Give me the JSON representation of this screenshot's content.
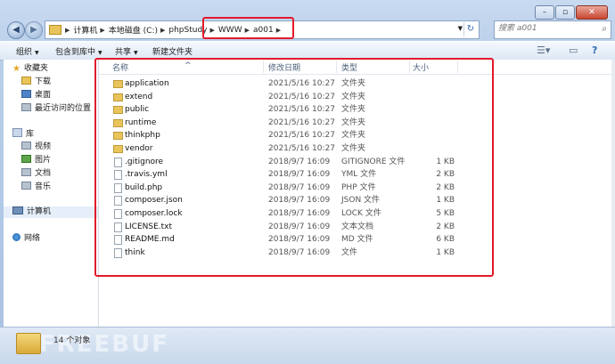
{
  "window": {
    "caption_buttons": [
      "minimize",
      "maximize",
      "close"
    ]
  },
  "address": {
    "crumbs": [
      "计算机",
      "本地磁盘 (C:)",
      "phpStudy",
      "WWW",
      "a001"
    ]
  },
  "search": {
    "placeholder": "搜索 a001"
  },
  "toolbar": {
    "organize": "组织",
    "include_library": "包含到库中",
    "share": "共享",
    "new_folder": "新建文件夹"
  },
  "sidebar": {
    "favorites": "收藏夹",
    "downloads": "下载",
    "desktop": "桌面",
    "recent": "最近访问的位置",
    "libraries": "库",
    "videos": "视频",
    "pictures": "图片",
    "documents": "文档",
    "music": "音乐",
    "computer": "计算机",
    "network": "网络"
  },
  "columns": {
    "name": "名称",
    "date": "修改日期",
    "type": "类型",
    "size": "大小"
  },
  "files": [
    {
      "name": "application",
      "date": "2021/5/16 10:27",
      "type": "文件夹",
      "size": "",
      "kind": "folder"
    },
    {
      "name": "extend",
      "date": "2021/5/16 10:27",
      "type": "文件夹",
      "size": "",
      "kind": "folder"
    },
    {
      "name": "public",
      "date": "2021/5/16 10:27",
      "type": "文件夹",
      "size": "",
      "kind": "folder"
    },
    {
      "name": "runtime",
      "date": "2021/5/16 10:27",
      "type": "文件夹",
      "size": "",
      "kind": "folder"
    },
    {
      "name": "thinkphp",
      "date": "2021/5/16 10:27",
      "type": "文件夹",
      "size": "",
      "kind": "folder"
    },
    {
      "name": "vendor",
      "date": "2021/5/16 10:27",
      "type": "文件夹",
      "size": "",
      "kind": "folder"
    },
    {
      "name": ".gitignore",
      "date": "2018/9/7 16:09",
      "type": "GITIGNORE 文件",
      "size": "1 KB",
      "kind": "file"
    },
    {
      "name": ".travis.yml",
      "date": "2018/9/7 16:09",
      "type": "YML 文件",
      "size": "2 KB",
      "kind": "file"
    },
    {
      "name": "build.php",
      "date": "2018/9/7 16:09",
      "type": "PHP 文件",
      "size": "2 KB",
      "kind": "file"
    },
    {
      "name": "composer.json",
      "date": "2018/9/7 16:09",
      "type": "JSON 文件",
      "size": "1 KB",
      "kind": "file"
    },
    {
      "name": "composer.lock",
      "date": "2018/9/7 16:09",
      "type": "LOCK 文件",
      "size": "5 KB",
      "kind": "file"
    },
    {
      "name": "LICENSE.txt",
      "date": "2018/9/7 16:09",
      "type": "文本文档",
      "size": "2 KB",
      "kind": "file"
    },
    {
      "name": "README.md",
      "date": "2018/9/7 16:09",
      "type": "MD 文件",
      "size": "6 KB",
      "kind": "file"
    },
    {
      "name": "think",
      "date": "2018/9/7 16:09",
      "type": "文件",
      "size": "1 KB",
      "kind": "file"
    }
  ],
  "status": {
    "count": "14 个对象",
    "watermark": "FREEBUF"
  },
  "colors": {
    "annotation_red": "#e3192c",
    "folder": "#e8c45a"
  }
}
